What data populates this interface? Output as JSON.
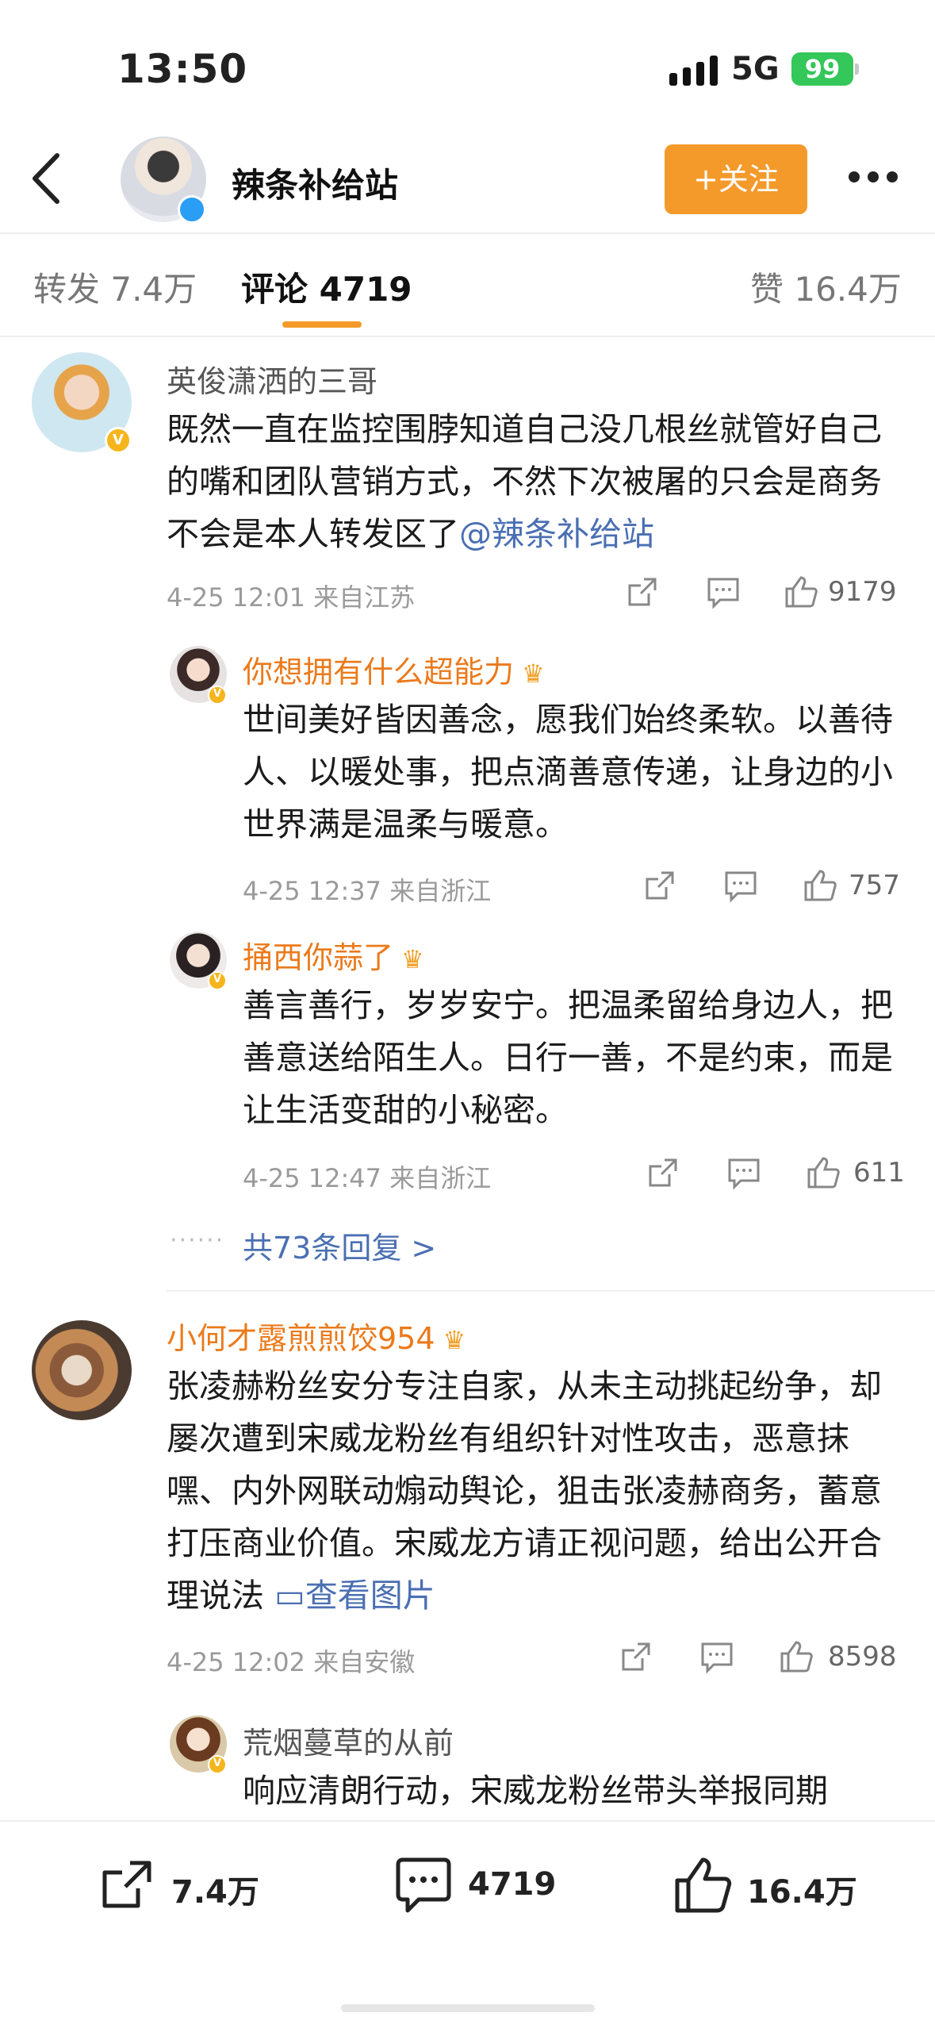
{
  "status_bar": {
    "time": "13:50",
    "network": "5G",
    "battery": "99"
  },
  "header": {
    "account_name": "辣条补给站",
    "follow_label": "+关注"
  },
  "tabs": [
    {
      "label": "转发 7.4万"
    },
    {
      "label": "评论 4719"
    },
    {
      "label": "赞 16.4万"
    }
  ],
  "comments": [
    {
      "user": "英俊潇洒的三哥",
      "text": "既然一直在监控围脖知道自己没几根丝就管好自己的嘴和团队营销方式，不然下次被屠的只会是商务不会是本人转发区了",
      "mention": "@辣条补给站",
      "meta": "4-25 12:01 来自江苏",
      "likes": "9179",
      "replies": [
        {
          "user": "你想拥有什么超能力",
          "text": "世间美好皆因善念，愿我们始终柔软。以善待人、以暖处事，把点滴善意传递，让身边的小世界满是温柔与暖意。",
          "meta": "4-25 12:37 来自浙江",
          "likes": "757"
        },
        {
          "user": "捅西你蒜了",
          "text": "善言善行，岁岁安宁。把温柔留给身边人，把善意送给陌生人。日行一善，不是约束，而是让生活变甜的小秘密。",
          "meta": "4-25 12:47 来自浙江",
          "likes": "611"
        }
      ],
      "more_replies": "共73条回复 >"
    },
    {
      "user": "小何才露煎煎饺954",
      "text": "张凌赫粉丝安分专注自家，从未主动挑起纷争，却屡次遭到宋威龙粉丝有组织针对性攻击，恶意抹嘿、内外网联动煽动舆论，狙击张凌赫商务，蓄意打压商业价值。宋威龙方请正视问题，给出公开合理说法",
      "pic_link": "查看图片",
      "meta": "4-25 12:02 来自安徽",
      "likes": "8598",
      "replies": [
        {
          "user": "荒烟蔓草的从前",
          "text": "响应清朗行动，宋威龙粉丝带头举报同期"
        }
      ]
    }
  ],
  "bottom_bar": {
    "repost": "7.4万",
    "comment": "4719",
    "like": "16.4万"
  },
  "colors": {
    "accent": "#f49a2b",
    "link": "#4a6fb3",
    "username_orange": "#eb7a1b",
    "verified_blue": "#2a9df4"
  }
}
